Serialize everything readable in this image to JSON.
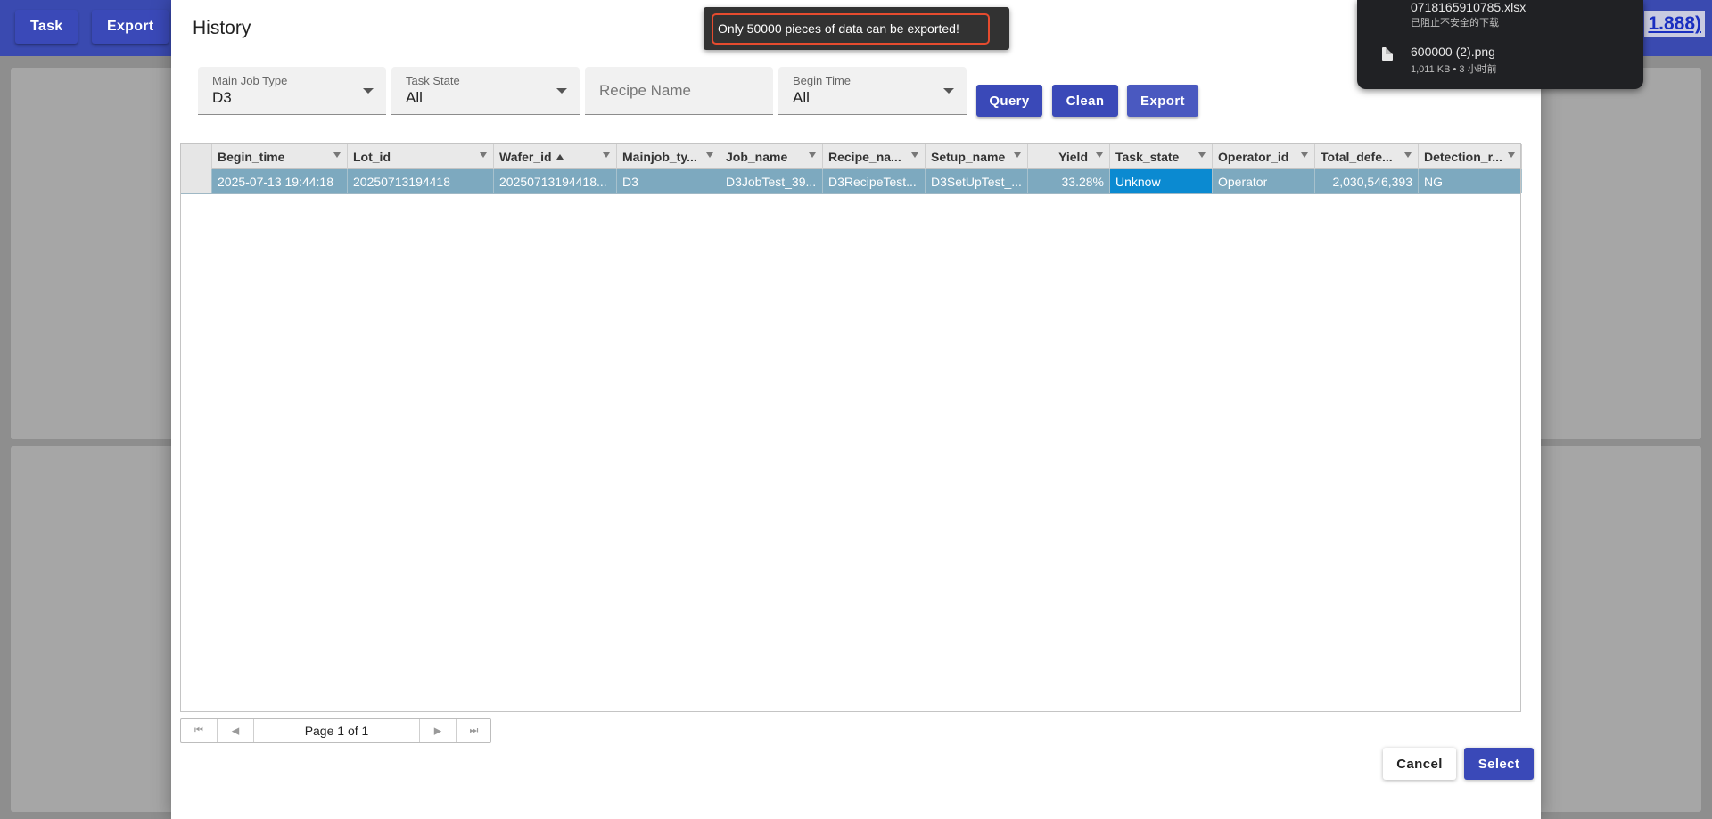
{
  "app": {
    "buttons": {
      "task": "Task",
      "export": "Export"
    },
    "link_text": "1.888)"
  },
  "dialog": {
    "title": "History",
    "filters": {
      "main_job_type": {
        "label": "Main Job Type",
        "value": "D3"
      },
      "task_state": {
        "label": "Task State",
        "value": "All"
      },
      "recipe_name": {
        "placeholder": "Recipe Name"
      },
      "begin_time": {
        "label": "Begin Time",
        "value": "All"
      }
    },
    "actions": {
      "query": "Query",
      "clean": "Clean",
      "export": "Export"
    },
    "grid": {
      "columns": [
        "Begin_time",
        "Lot_id",
        "Wafer_id",
        "Mainjob_ty...",
        "Job_name",
        "Recipe_na...",
        "Setup_name",
        "Yield",
        "Task_state",
        "Operator_id",
        "Total_defe...",
        "Detection_r..."
      ],
      "sorted_column": "Wafer_id",
      "rows": [
        [
          "2025-07-13 19:44:18",
          "20250713194418",
          "20250713194418...",
          "D3",
          "D3JobTest_39...",
          "D3RecipeTest...",
          "D3SetUpTest_...",
          "33.28%",
          "Unknow",
          "Operator",
          "2,030,546,393",
          "NG"
        ]
      ]
    },
    "pager": {
      "text": "Page 1 of 1"
    },
    "footer": {
      "cancel": "Cancel",
      "select": "Select"
    }
  },
  "toast": {
    "message": "Only 50000 pieces of data can be exported!"
  },
  "downloads": {
    "items": [
      {
        "name": "0718165910785.xlsx",
        "status": "已阻止不安全的下载"
      },
      {
        "name": "600000 (2).png",
        "status": "1,011 KB • 3 小时前"
      }
    ]
  },
  "colors": {
    "primary": "#3a49b8",
    "row_selected": "#7da9bf",
    "cell_selected": "#0b8ad1",
    "toast_border": "#e54b2e"
  }
}
